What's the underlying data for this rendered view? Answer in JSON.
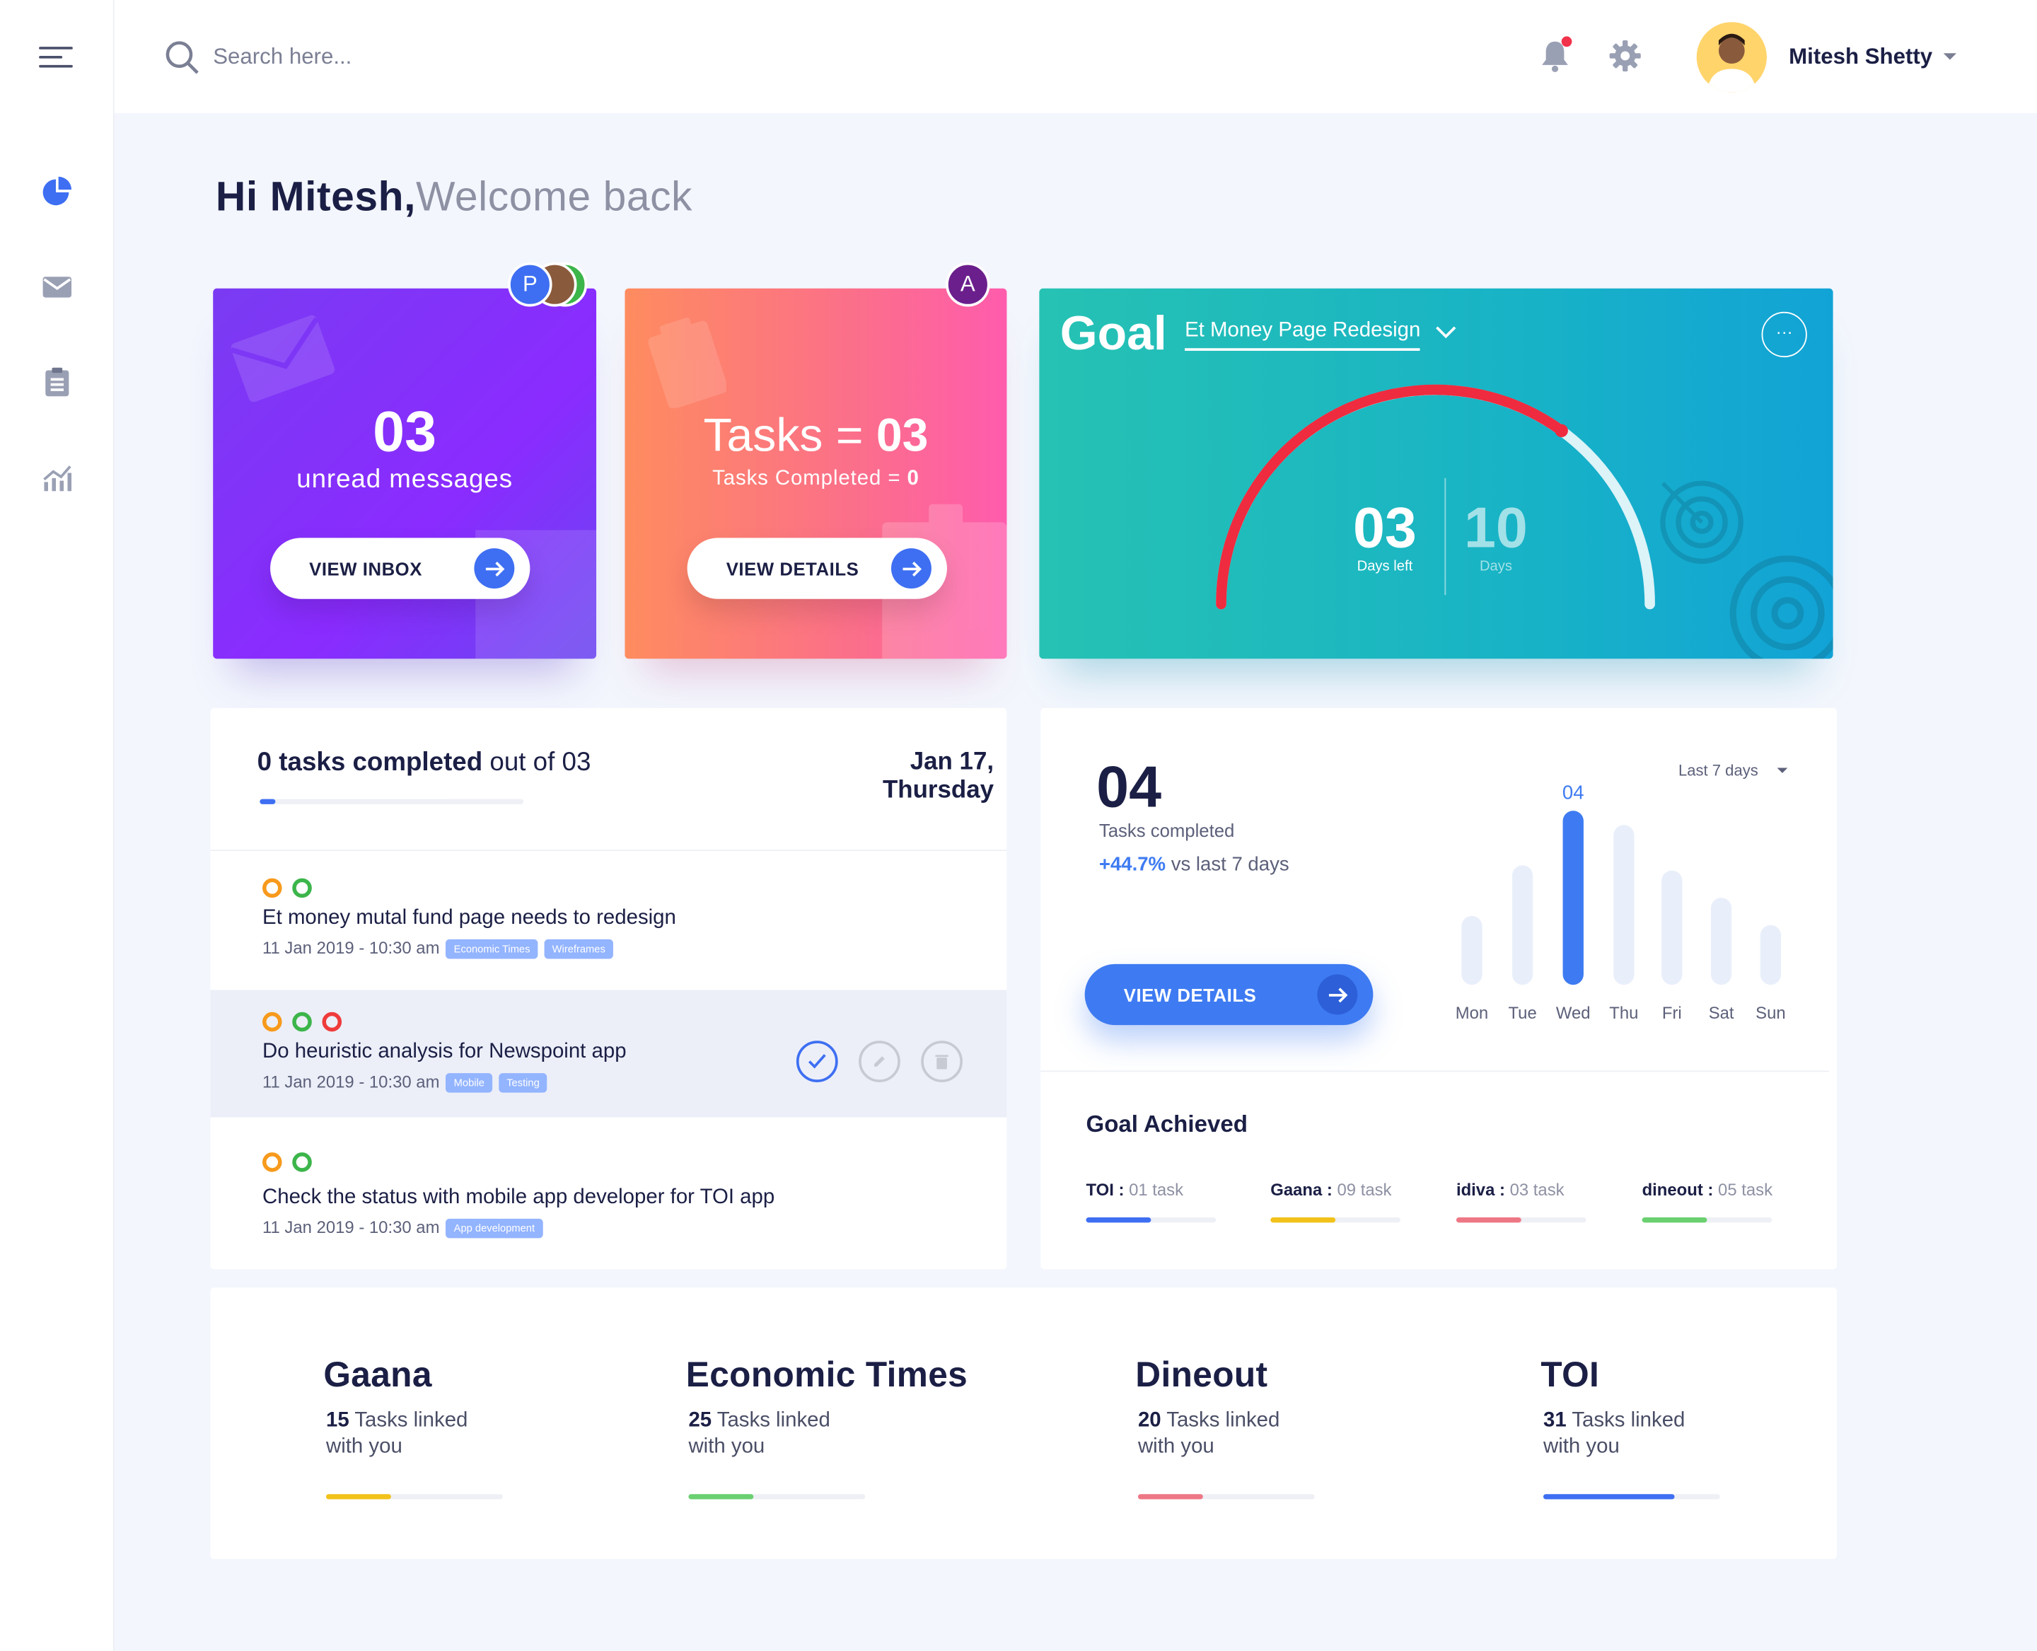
{
  "search": {
    "placeholder": "Search here..."
  },
  "user": {
    "name": "Mitesh Shetty"
  },
  "greeting": {
    "name": "Hi Mitesh,",
    "sub": "Welcome back"
  },
  "messages_card": {
    "count": "03",
    "label": "unread messages",
    "button": "VIEW INBOX",
    "avatars": [
      "P"
    ]
  },
  "tasks_card": {
    "title_prefix": "Tasks = ",
    "count": "03",
    "completed_prefix": "Tasks Completed = ",
    "completed_value": "0",
    "button": "VIEW DETAILS",
    "avatar": "A"
  },
  "goal_card": {
    "title": "Goal",
    "project": "Et Money Page Redesign",
    "more": "···",
    "days_left": "03",
    "days_left_label": "Days left",
    "days_total": "10",
    "days_total_label": "Days",
    "progress": 0.7
  },
  "task_summary": {
    "completed": "0 tasks completed",
    "out_of": " out of 03",
    "date_line1": "Jan 17,",
    "date_line2": "Thursday",
    "progress": 0.06
  },
  "tasks": [
    {
      "title": "Et money mutal fund page needs to redesign",
      "meta": "11 Jan 2019 - 10:30 am",
      "tags": [
        "Economic Times",
        "Wireframes"
      ],
      "rings": [
        "#f79a1c",
        "#3cb54a"
      ]
    },
    {
      "title": "Do heuristic analysis for Newspoint app",
      "meta": "11 Jan 2019 - 10:30 am",
      "tags": [
        "Mobile",
        "Testing"
      ],
      "rings": [
        "#f79a1c",
        "#3cb54a",
        "#ef3b3b"
      ]
    },
    {
      "title": "Check the status with mobile app developer for TOI app",
      "meta": "11 Jan 2019 - 10:30 am",
      "tags": [
        "App development"
      ],
      "rings": [
        "#f79a1c",
        "#3cb54a"
      ]
    }
  ],
  "stats": {
    "count": "04",
    "label": "Tasks completed",
    "change": "+44.7%",
    "change_label": " vs last 7 days",
    "range": "Last 7 days",
    "button": "VIEW DETAILS"
  },
  "chart_data": {
    "type": "bar",
    "categories": [
      "Mon",
      "Tue",
      "Wed",
      "Thu",
      "Fri",
      "Sat",
      "Sun"
    ],
    "values": [
      1.5,
      2.6,
      3.8,
      3.5,
      2.5,
      1.9,
      1.3
    ],
    "highlight_index": 2,
    "highlight_label": "04",
    "highlight_color": "#3e7bf2",
    "base_color": "#e9effa"
  },
  "goal_achieved": {
    "title": "Goal Achieved",
    "items": [
      {
        "name": "TOI :",
        "value": " 01 task",
        "fraction": 0.5,
        "color": "#3e6ff2"
      },
      {
        "name": "Gaana :",
        "value": " 09 task",
        "fraction": 0.5,
        "color": "#f2c21b"
      },
      {
        "name": "idiva :",
        "value": " 03 task",
        "fraction": 0.5,
        "color": "#ee7785"
      },
      {
        "name": "dineout :",
        "value": " 05 task",
        "fraction": 0.5,
        "color": "#6ad070"
      }
    ]
  },
  "brands": [
    {
      "name": "Gaana",
      "count": "15",
      "text1": " Tasks linked",
      "text2": "with you",
      "fraction": 0.37,
      "color": "#f2c21b"
    },
    {
      "name": "Economic Times",
      "count": "25",
      "text1": " Tasks linked",
      "text2": "with you",
      "fraction": 0.37,
      "color": "#6ad070"
    },
    {
      "name": "Dineout",
      "count": "20",
      "text1": " Tasks linked",
      "text2": "with you",
      "fraction": 0.37,
      "color": "#ee7785"
    },
    {
      "name": "TOI",
      "count": "31",
      "text1": " Tasks linked",
      "text2": "with you",
      "fraction": 0.74,
      "color": "#3e6ff2"
    }
  ]
}
